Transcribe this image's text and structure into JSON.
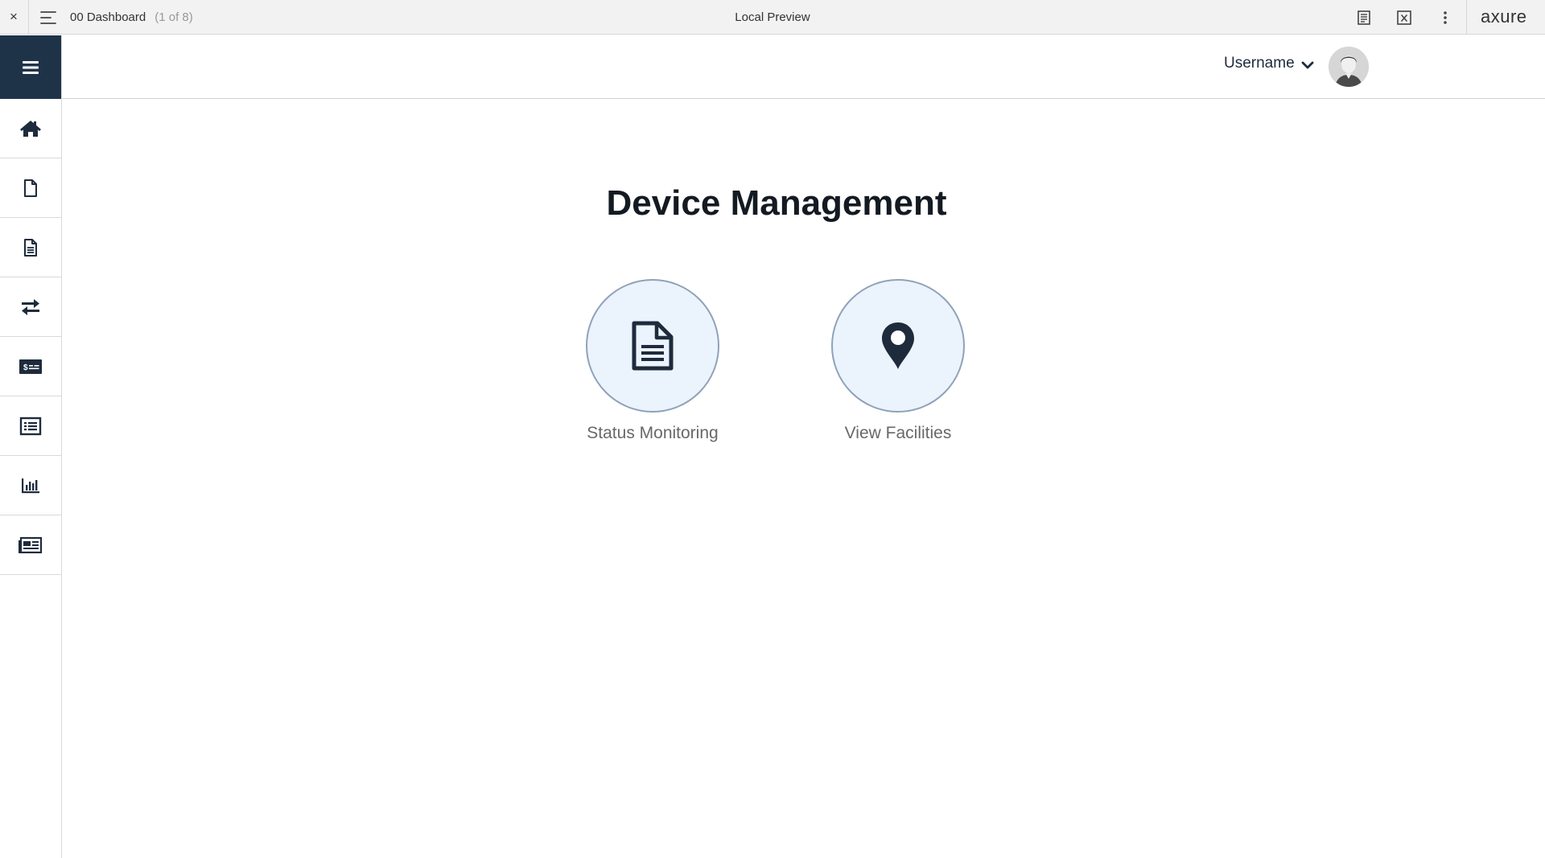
{
  "toolbar": {
    "close_glyph": "×",
    "page_name": "00 Dashboard",
    "page_count": "(1 of 8)",
    "title": "Local Preview",
    "logo": "axure"
  },
  "sidebar": {
    "items": [
      {
        "name": "home",
        "icon": "home-icon"
      },
      {
        "name": "document",
        "icon": "file-icon"
      },
      {
        "name": "report",
        "icon": "file-text-icon"
      },
      {
        "name": "transfer",
        "icon": "exchange-icon"
      },
      {
        "name": "billing",
        "icon": "money-card-icon"
      },
      {
        "name": "list",
        "icon": "list-icon"
      },
      {
        "name": "statistics",
        "icon": "bar-chart-icon"
      },
      {
        "name": "news",
        "icon": "newspaper-icon"
      }
    ]
  },
  "header": {
    "username": "Username"
  },
  "main": {
    "title": "Device Management",
    "tiles": [
      {
        "label": "Status Monitoring",
        "icon": "document-icon"
      },
      {
        "label": "View Facilities",
        "icon": "map-pin-icon"
      }
    ]
  },
  "colors": {
    "nav_dark": "#1e3348",
    "tile_bg": "#ebf3fd",
    "tile_border": "#8fa2b8",
    "icon": "#1e2b3c"
  }
}
